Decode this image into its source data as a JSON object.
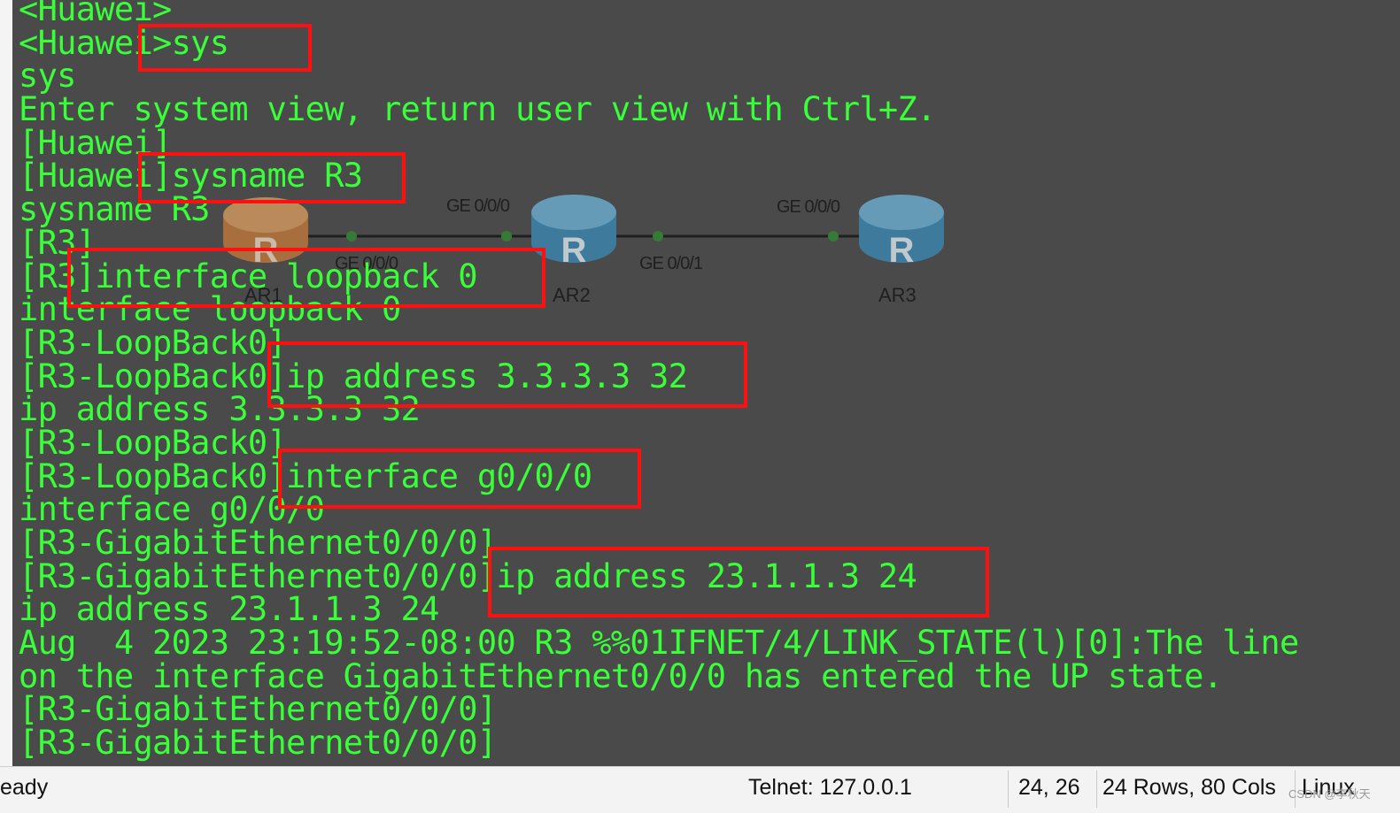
{
  "terminal": {
    "lines": [
      "<Huawei>",
      "<Huawei>sys",
      "sys",
      "Enter system view, return user view with Ctrl+Z.",
      "[Huawei]",
      "[Huawei]sysname R3",
      "sysname R3",
      "[R3]",
      "[R3]interface loopback 0",
      "interface loopback 0",
      "[R3-LoopBack0]",
      "[R3-LoopBack0]ip address 3.3.3.3 32",
      "ip address 3.3.3.3 32",
      "[R3-LoopBack0]",
      "[R3-LoopBack0]interface g0/0/0",
      "interface g0/0/0",
      "[R3-GigabitEthernet0/0/0]",
      "[R3-GigabitEthernet0/0/0]ip address 23.1.1.3 24",
      "ip address 23.1.1.3 24",
      "Aug  4 2023 23:19:52-08:00 R3 %%01IFNET/4/LINK_STATE(l)[0]:The line",
      "on the interface GigabitEthernet0/0/0 has entered the UP state.",
      "[R3-GigabitEthernet0/0/0]",
      "[R3-GigabitEthernet0/0/0]"
    ],
    "text_color": "#39ff39",
    "background": "#4a4a4a",
    "highlight_color": "#ff1010"
  },
  "topology": {
    "routers": [
      {
        "name": "AR1",
        "color": "#c87a3a"
      },
      {
        "name": "AR2",
        "color": "#3a8ab8"
      },
      {
        "name": "AR3",
        "color": "#3a8ab8"
      }
    ],
    "port_labels": [
      "GE 0/0/0",
      "GE 0/0/0",
      "GE 0/0/1",
      "GE 0/0/0"
    ]
  },
  "statusbar": {
    "state": "eady",
    "connection": "Telnet: 127.0.0.1",
    "cursor": "24,  26",
    "size": "24 Rows, 80 Cols",
    "os": "Linux",
    "watermark": "CSDN @李秋天"
  }
}
